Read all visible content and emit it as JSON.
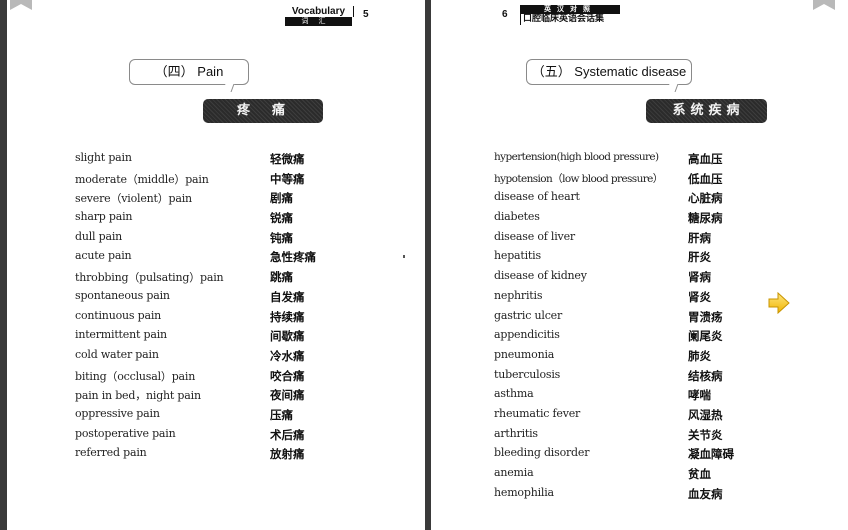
{
  "viewer": {
    "left_page": {
      "page_number": "5",
      "header": {
        "english": "Vocabulary",
        "chinese": "词汇"
      },
      "section_title": "（四） Pain",
      "section_banner": "疼痛",
      "entries": [
        {
          "en": "slight pain",
          "zh": "轻微痛"
        },
        {
          "en": "moderate（middle）pain",
          "zh": "中等痛"
        },
        {
          "en": "severe（violent）pain",
          "zh": "剧痛"
        },
        {
          "en": "sharp pain",
          "zh": "锐痛"
        },
        {
          "en": "dull pain",
          "zh": "钝痛"
        },
        {
          "en": "acute pain",
          "zh": "急性疼痛"
        },
        {
          "en": "throbbing（pulsating）pain",
          "zh": "跳痛"
        },
        {
          "en": "spontaneous pain",
          "zh": "自发痛"
        },
        {
          "en": "continuous pain",
          "zh": "持续痛"
        },
        {
          "en": "intermittent pain",
          "zh": "间歇痛"
        },
        {
          "en": "cold water pain",
          "zh": "冷水痛"
        },
        {
          "en": "biting（occlusal）pain",
          "zh": "咬合痛"
        },
        {
          "en": "pain in bed，night pain",
          "zh": "夜间痛"
        },
        {
          "en": "oppressive pain",
          "zh": "压痛"
        },
        {
          "en": "postoperative pain",
          "zh": "术后痛"
        },
        {
          "en": "referred pain",
          "zh": "放射痛"
        }
      ]
    },
    "right_page": {
      "page_number": "6",
      "header": {
        "top": "英汉对照",
        "bottom": "口腔临床英语会话集"
      },
      "section_title": "（五） Systematic disease",
      "section_banner": "系统疾病",
      "entries": [
        {
          "en": "hypertension(high blood pressure)",
          "zh": "高血压"
        },
        {
          "en": "hypotension（low blood pressure）",
          "zh": "低血压"
        },
        {
          "en": "disease of heart",
          "zh": "心脏病"
        },
        {
          "en": "diabetes",
          "zh": "糖尿病"
        },
        {
          "en": "disease of liver",
          "zh": "肝病"
        },
        {
          "en": "hepatitis",
          "zh": "肝炎"
        },
        {
          "en": "disease of kidney",
          "zh": "肾病"
        },
        {
          "en": "nephritis",
          "zh": "肾炎"
        },
        {
          "en": "gastric ulcer",
          "zh": "胃溃疡"
        },
        {
          "en": "appendicitis",
          "zh": "阑尾炎"
        },
        {
          "en": "pneumonia",
          "zh": "肺炎"
        },
        {
          "en": "tuberculosis",
          "zh": "结核病"
        },
        {
          "en": "asthma",
          "zh": "哮喘"
        },
        {
          "en": "rheumatic fever",
          "zh": "风湿热"
        },
        {
          "en": "arthritis",
          "zh": "关节炎"
        },
        {
          "en": "bleeding disorder",
          "zh": "凝血障碍"
        },
        {
          "en": "anemia",
          "zh": "贫血"
        },
        {
          "en": "hemophilia",
          "zh": "血友病"
        }
      ]
    },
    "icons": {
      "bookmark": "bookmark-icon",
      "next_page": "arrow-right-icon",
      "arrow_color": "#f5c518"
    }
  }
}
